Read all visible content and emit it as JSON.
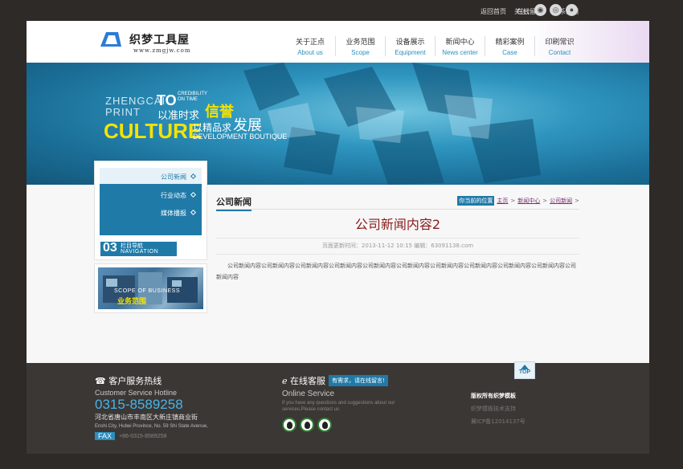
{
  "topbar": {
    "links": [
      "返回首页",
      "在线留言",
      "联系我们"
    ],
    "follow_label": "关注："
  },
  "header": {
    "logo_text": "织梦工具屋",
    "logo_url": "www.zmgjw.com",
    "nav": [
      {
        "cn": "关于正点",
        "en": "About us"
      },
      {
        "cn": "业务范围",
        "en": "Scope"
      },
      {
        "cn": "设备展示",
        "en": "Equipment"
      },
      {
        "cn": "新闻中心",
        "en": "News center"
      },
      {
        "cn": "精彩案例",
        "en": "Case"
      },
      {
        "cn": "印刷常识",
        "en": "Contact"
      }
    ]
  },
  "banner": {
    "zhengcai": "ZHENGCAI",
    "print": "PRINT",
    "to": "TO",
    "credibility": "CREDIBILITY",
    "on_time": "ON TIME",
    "cn_line1": "以准时求",
    "xinyu": "信誉",
    "culture": "CULTURE",
    "cn_line2": "以精品求",
    "fazhan": "发展",
    "dev": "DEVELOPMENT BOUTIQUE"
  },
  "sidebar": {
    "items": [
      {
        "label": "公司新闻",
        "active": true
      },
      {
        "label": "行业动态",
        "active": false
      },
      {
        "label": "媒体播报",
        "active": false
      }
    ],
    "nav_num": "03",
    "nav_cn": "栏目导航",
    "nav_en": "NAVIGATION",
    "scope_en": "SCOPE OF BUSINESS",
    "scope_cn": "业务范围"
  },
  "article": {
    "section_title": "公司新闻",
    "crumb_tag": "你当前的位置",
    "crumbs": [
      "主页",
      "新闻中心",
      "公司新闻"
    ],
    "headline": "公司新闻内容2",
    "meta": "页面更新时间：2013-11-12 10:15  编辑：63091138.com",
    "body": "公司新闻内容公司新闻内容公司新闻内容公司新闻内容公司新闻内容公司新闻内容公司新闻内容公司新闻内容公司新闻内容公司新闻内容公司新闻内容"
  },
  "footer": {
    "top_label": "TOP",
    "hotline_title": "客户服务热线",
    "hotline_en": "Customer Service Hotline",
    "phone": "0315-8589258",
    "address_cn": "河北省唐山市丰南区大新庄镇商业街",
    "address_en": "Enshi City, Hubei Province, No. 59 Shi State Avenue,",
    "fax_label": "FAX",
    "fax_number": "+86-0315-8589258",
    "online_title": "在线客服",
    "online_tag": "有需求，请在线留言!",
    "online_en": "Online Service",
    "online_desc": "If you have any questions and suggestions about our services.Please contact us",
    "copyright": "版权所有织梦模板",
    "tech_support": "织梦模板技术支持",
    "icp": "冀ICP备12014137号"
  }
}
